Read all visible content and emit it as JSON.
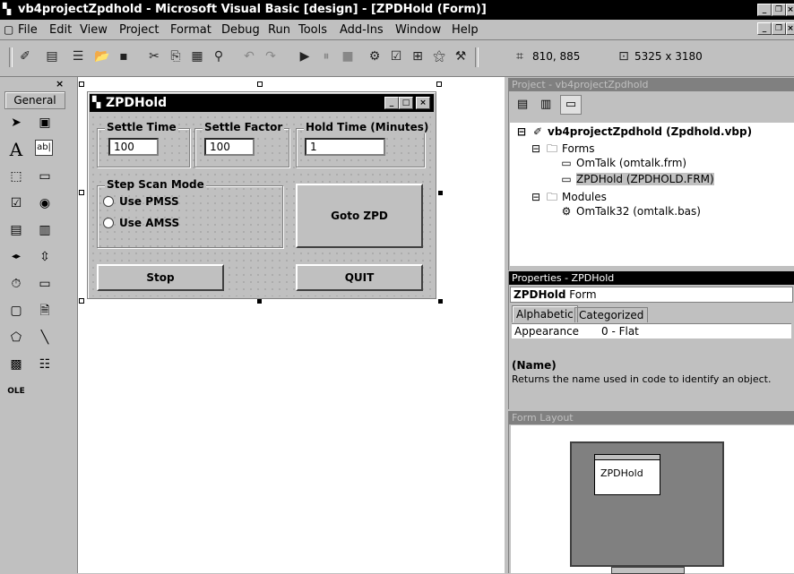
{
  "window": {
    "title": "vb4projectZpdhold - Microsoft Visual Basic [design] - [ZPDHold (Form)]",
    "controls": [
      "_",
      "❐",
      "×"
    ],
    "mdi_controls": [
      "_",
      "❐",
      "×"
    ]
  },
  "menu": [
    "File",
    "Edit",
    "View",
    "Project",
    "Format",
    "Debug",
    "Run",
    "Tools",
    "Add-Ins",
    "Window",
    "Help"
  ],
  "toolbar": {
    "position": "810, 885",
    "size": "5325 x 3180"
  },
  "toolbox": {
    "label": "General",
    "close": "×"
  },
  "form": {
    "title": "ZPDHold",
    "frames": {
      "settle_time": "Settle Time",
      "settle_factor": "Settle Factor",
      "hold_time": "Hold Time (Minutes)",
      "step_scan": "Step Scan Mode"
    },
    "fields": {
      "settle_time": "100",
      "settle_factor": "100",
      "hold_time": "1"
    },
    "radios": {
      "pmss": "Use PMSS",
      "amss": "Use AMSS"
    },
    "buttons": {
      "goto": "Goto ZPD",
      "stop": "Stop",
      "quit": "QUIT"
    }
  },
  "project": {
    "title": "Project - vb4projectZpdhold",
    "root": "vb4projectZpdhold (Zpdhold.vbp)",
    "forms_folder": "Forms",
    "forms": [
      "OmTalk (omtalk.frm)",
      "ZPDHold (ZPDHOLD.FRM)"
    ],
    "modules_folder": "Modules",
    "modules": [
      "OmTalk32 (omtalk.bas)"
    ]
  },
  "properties": {
    "title": "Properties - ZPDHold",
    "object": "ZPDHold",
    "object_type": "Form",
    "tabs": [
      "Alphabetic",
      "Categorized"
    ],
    "row_name": "Appearance",
    "row_value": "0 - Flat",
    "desc_title": "(Name)",
    "desc_text": "Returns the name used in code to identify an object."
  },
  "layout_window": {
    "title": "Form Layout",
    "form_label": "ZPDHold"
  }
}
